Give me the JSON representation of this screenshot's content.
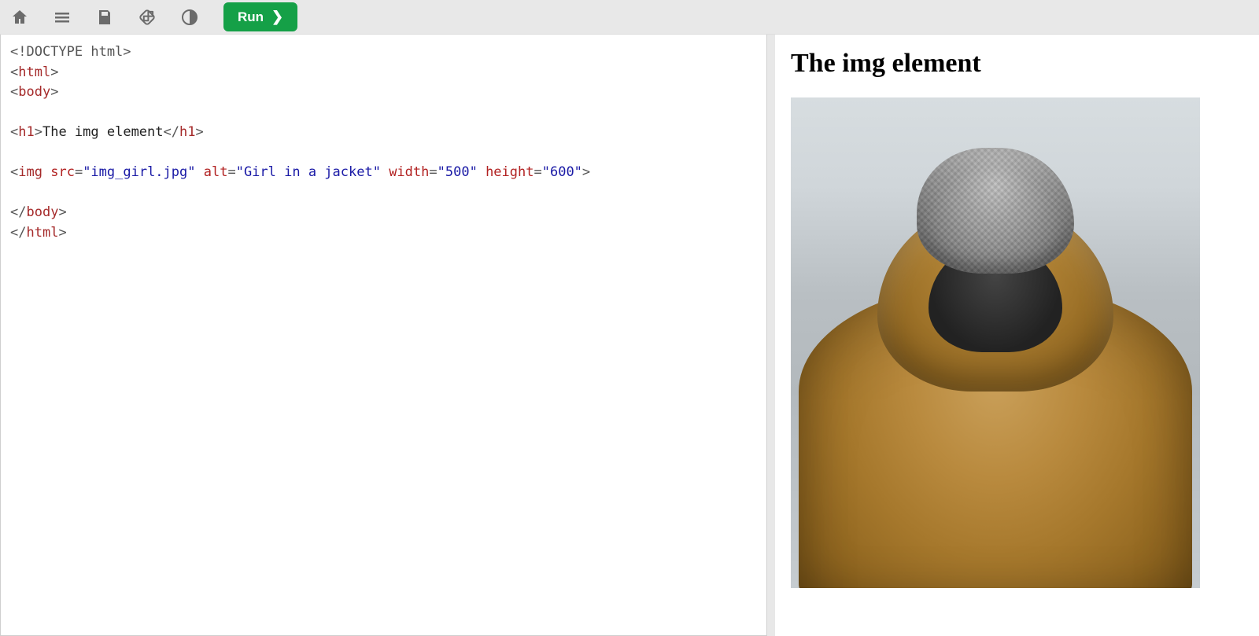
{
  "toolbar": {
    "icons": {
      "home": "home-icon",
      "menu": "menu-icon",
      "save": "save-icon",
      "rotate": "rotate-icon",
      "theme": "theme-icon"
    },
    "run_label": "Run",
    "run_chevron": "❯"
  },
  "editor": {
    "lines": [
      {
        "type": "doctype",
        "text": "<!DOCTYPE html>"
      },
      {
        "type": "open",
        "tag": "html"
      },
      {
        "type": "open",
        "tag": "body"
      },
      {
        "type": "blank"
      },
      {
        "type": "h1",
        "open": "h1",
        "text": "The img element",
        "close": "h1"
      },
      {
        "type": "blank"
      },
      {
        "type": "img",
        "tag": "img",
        "attrs": [
          {
            "name": "src",
            "value": "img_girl.jpg"
          },
          {
            "name": "alt",
            "value": "Girl in a jacket"
          },
          {
            "name": "width",
            "value": "500"
          },
          {
            "name": "height",
            "value": "600"
          }
        ]
      },
      {
        "type": "blank"
      },
      {
        "type": "close",
        "tag": "body"
      },
      {
        "type": "close",
        "tag": "html"
      }
    ]
  },
  "preview": {
    "heading": "The img element",
    "image_alt": "Girl in a jacket",
    "image_width": "500",
    "image_height": "600"
  }
}
